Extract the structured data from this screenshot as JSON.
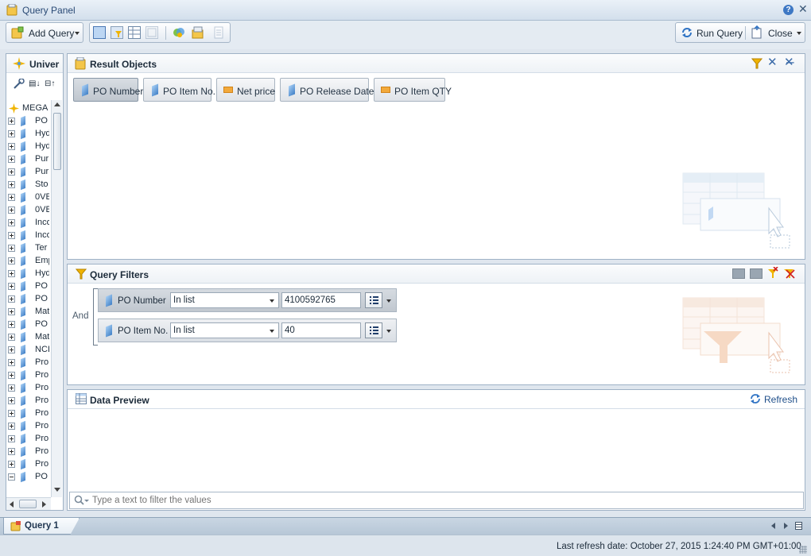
{
  "window": {
    "title": "Query Panel"
  },
  "toolbar": {
    "add_query_label": "Add Query",
    "run_query_label": "Run Query",
    "close_label": "Close"
  },
  "universe": {
    "tab_label": "Univer",
    "root_label": "MEGA",
    "items": [
      "PO",
      "Hyd",
      "Hyd",
      "Pur",
      "Pur",
      "Sto",
      "0VE",
      "0VE",
      "Inco",
      "Inco",
      "Ter",
      "Emp",
      "Hyd",
      "PO",
      "PO",
      "Mat",
      "PO",
      "Mat",
      "NCI",
      "Pro",
      "Pro",
      "Pro",
      "Pro",
      "Pro",
      "Pro",
      "Pro",
      "Pro",
      "Pro",
      "PO"
    ]
  },
  "result_objects": {
    "title": "Result Objects",
    "items": [
      {
        "label": "PO Number",
        "type": "dimension",
        "selected": true
      },
      {
        "label": "PO Item No.",
        "type": "dimension",
        "selected": false
      },
      {
        "label": "Net price",
        "type": "measure",
        "selected": false
      },
      {
        "label": "PO Release Date",
        "type": "dimension",
        "selected": false
      },
      {
        "label": "PO Item QTY",
        "type": "measure",
        "selected": false
      }
    ]
  },
  "query_filters": {
    "title": "Query Filters",
    "operator_label": "And",
    "filters": [
      {
        "object": "PO Number",
        "operator": "In list",
        "value": "4100592765"
      },
      {
        "object": "PO Item No.",
        "operator": "In list",
        "value": "40"
      }
    ]
  },
  "data_preview": {
    "title": "Data Preview",
    "refresh_label": "Refresh",
    "filter_placeholder": "Type a text to filter the values"
  },
  "query_tab": {
    "label": "Query 1"
  },
  "status": {
    "last_refresh": "Last refresh date: October 27, 2015 1:24:40 PM GMT+01:00"
  },
  "colors": {
    "accent": "#2a4a75",
    "panel_border": "#9fb2c6",
    "filter_icon": "#f0b400"
  }
}
